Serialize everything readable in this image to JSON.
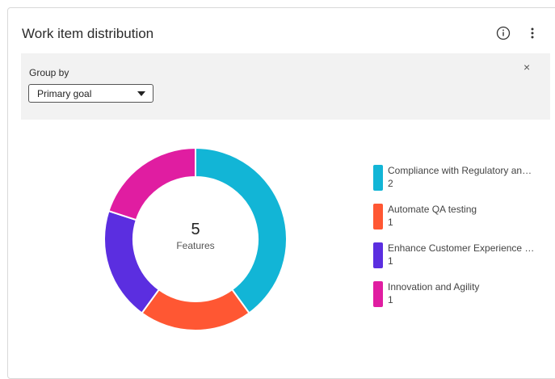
{
  "widget": {
    "title": "Work item distribution",
    "info_icon": "info-icon",
    "menu_icon": "kebab-menu-icon"
  },
  "filter": {
    "group_by_label": "Group by",
    "selected": "Primary goal",
    "close_icon": "close-icon",
    "close_glyph": "×"
  },
  "center": {
    "value": "5",
    "label": "Features"
  },
  "chart_data": {
    "type": "pie",
    "donut": true,
    "categories": [
      "Compliance with Regulatory an…",
      "Automate QA testing",
      "Enhance Customer Experience …",
      "Innovation and Agility"
    ],
    "values": [
      2,
      1,
      1,
      1
    ],
    "colors": [
      "#12b5d6",
      "#ff5733",
      "#5b2ee0",
      "#e01da1"
    ],
    "legend_placement": "right"
  },
  "legend": [
    {
      "name": "Compliance with Regulatory an…",
      "count": "2",
      "color": "#12b5d6"
    },
    {
      "name": "Automate QA testing",
      "count": "1",
      "color": "#ff5733"
    },
    {
      "name": "Enhance Customer Experience …",
      "count": "1",
      "color": "#5b2ee0"
    },
    {
      "name": "Innovation and Agility",
      "count": "1",
      "color": "#e01da1"
    }
  ]
}
